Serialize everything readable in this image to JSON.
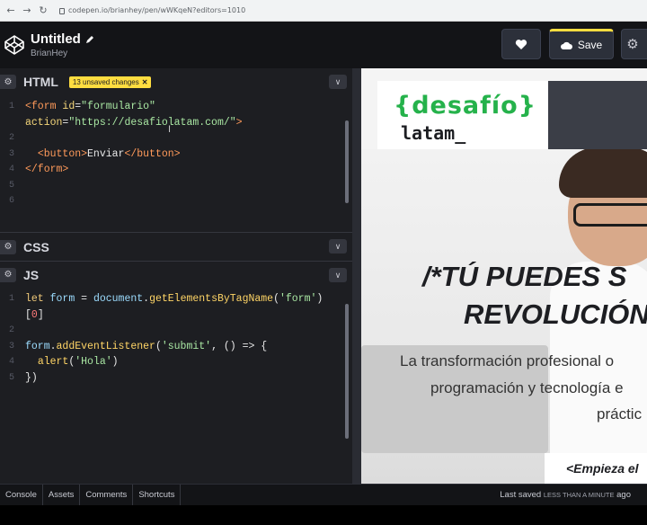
{
  "browser": {
    "url": "codepen.io/brianhey/pen/wWKqeN?editors=1010"
  },
  "header": {
    "title": "Untitled",
    "author": "BrianHey",
    "save_label": "Save"
  },
  "panels": {
    "html": {
      "name": "HTML",
      "badge": "13 unsaved changes"
    },
    "css": {
      "name": "CSS"
    },
    "js": {
      "name": "JS"
    }
  },
  "html_code": {
    "lines": [
      {
        "n": "1",
        "parts": [
          [
            "t-tag",
            "<form "
          ],
          [
            "t-attr",
            "id"
          ],
          [
            "",
            "="
          ],
          [
            "t-str",
            "\"formulario\""
          ]
        ]
      },
      {
        "n": "",
        "parts": [
          [
            "t-attr",
            "action"
          ],
          [
            "",
            "="
          ],
          [
            "t-str",
            "\"https://desafiolatam.com/\""
          ],
          [
            "t-tag",
            ">"
          ]
        ]
      },
      {
        "n": "2",
        "parts": []
      },
      {
        "n": "3",
        "parts": [
          [
            "",
            "  "
          ],
          [
            "t-tag",
            "<button>"
          ],
          [
            "",
            "Enviar"
          ],
          [
            "t-tag",
            "</button>"
          ]
        ]
      },
      {
        "n": "4",
        "parts": [
          [
            "t-tag",
            "</form>"
          ]
        ]
      },
      {
        "n": "5",
        "parts": []
      },
      {
        "n": "6",
        "parts": []
      }
    ]
  },
  "js_code": {
    "lines": [
      {
        "n": "1",
        "parts": [
          [
            "t-kw",
            "let "
          ],
          [
            "t-var",
            "form"
          ],
          [
            "",
            " = "
          ],
          [
            "t-var",
            "document"
          ],
          [
            "",
            "."
          ],
          [
            "t-fn",
            "getElementsByTagName"
          ],
          [
            "",
            "("
          ],
          [
            "t-str",
            "'form'"
          ],
          [
            "",
            ")"
          ]
        ]
      },
      {
        "n": "",
        "parts": [
          [
            "",
            "["
          ],
          [
            "t-num",
            "0"
          ],
          [
            "",
            "]"
          ]
        ]
      },
      {
        "n": "2",
        "parts": []
      },
      {
        "n": "3",
        "parts": [
          [
            "t-var",
            "form"
          ],
          [
            "",
            "."
          ],
          [
            "t-fn",
            "addEventListener"
          ],
          [
            "",
            "("
          ],
          [
            "t-str",
            "'submit'"
          ],
          [
            "",
            ", () => {"
          ]
        ]
      },
      {
        "n": "4",
        "parts": [
          [
            "",
            "  "
          ],
          [
            "t-fn",
            "alert"
          ],
          [
            "",
            "("
          ],
          [
            "t-str",
            "'Hola'"
          ],
          [
            "",
            ")"
          ]
        ]
      },
      {
        "n": "5",
        "parts": [
          [
            "",
            "})"
          ]
        ]
      }
    ]
  },
  "preview": {
    "logo_top": "{desafío}",
    "logo_bottom": "latam_",
    "headline_1": "/*TÚ PUEDES S",
    "headline_2": "REVOLUCIÓN",
    "sub_1": "La transformación profesional o",
    "sub_2": "programación y tecnología e",
    "sub_3": "práctic",
    "cta": "<Empieza el"
  },
  "footer": {
    "console": "Console",
    "assets": "Assets",
    "comments": "Comments",
    "shortcuts": "Shortcuts",
    "last_saved": "Last saved",
    "last_saved_ago": "LESS THAN A MINUTE",
    "ago": "ago"
  },
  "colors": {
    "accent": "#ffdd40",
    "bg": "#1d1e22",
    "header_bg": "#131417",
    "brand_green": "#25b24b"
  }
}
